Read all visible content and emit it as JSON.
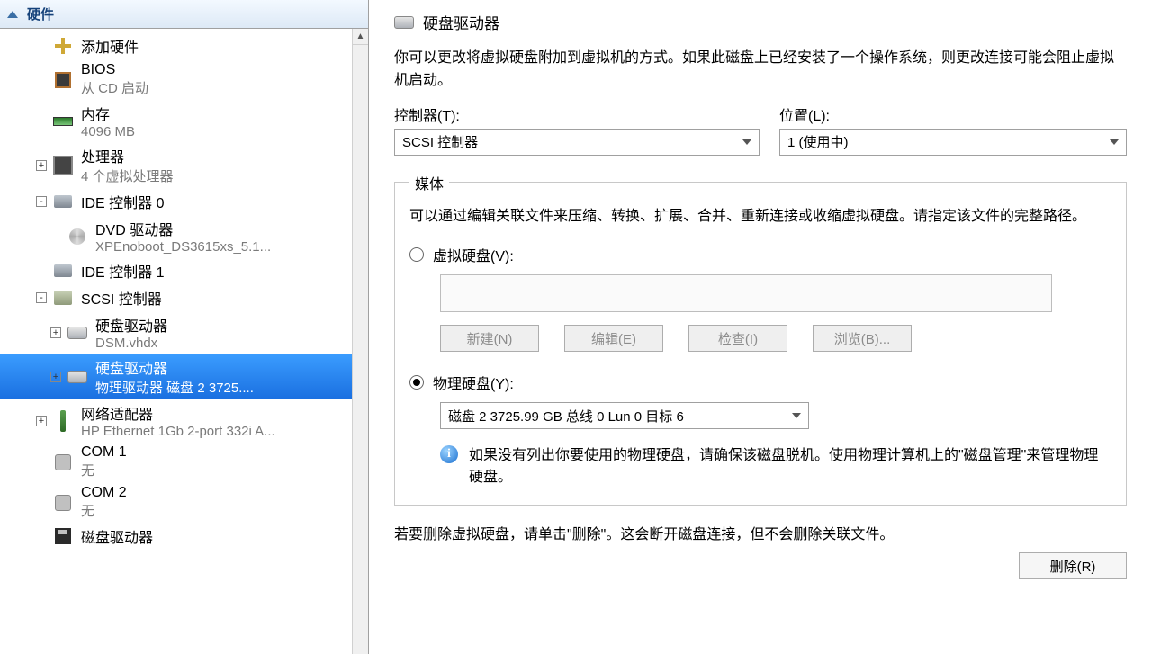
{
  "left": {
    "header": "硬件",
    "items": [
      {
        "label": "添加硬件",
        "sub": "",
        "icon": "plus"
      },
      {
        "label": "BIOS",
        "sub": "从 CD 启动",
        "icon": "chip"
      },
      {
        "label": "内存",
        "sub": "4096 MB",
        "icon": "ram"
      },
      {
        "label": "处理器",
        "sub": "4 个虚拟处理器",
        "icon": "cpu",
        "exp": "+"
      },
      {
        "label": "IDE 控制器 0",
        "sub": "",
        "icon": "ide",
        "exp": "-"
      },
      {
        "label": "DVD 驱动器",
        "sub": "XPEnoboot_DS3615xs_5.1...",
        "icon": "dvd",
        "indent": 2
      },
      {
        "label": "IDE 控制器 1",
        "sub": "",
        "icon": "ide"
      },
      {
        "label": "SCSI 控制器",
        "sub": "",
        "icon": "scsi",
        "exp": "-"
      },
      {
        "label": "硬盘驱动器",
        "sub": "DSM.vhdx",
        "icon": "hdd",
        "indent": 2,
        "exp": "+"
      },
      {
        "label": "硬盘驱动器",
        "sub": "物理驱动器 磁盘 2 3725....",
        "icon": "hdd",
        "indent": 2,
        "exp": "+",
        "selected": true
      },
      {
        "label": "网络适配器",
        "sub": "HP Ethernet 1Gb 2-port 332i A...",
        "icon": "nic",
        "exp": "+"
      },
      {
        "label": "COM 1",
        "sub": "无",
        "icon": "com"
      },
      {
        "label": "COM 2",
        "sub": "无",
        "icon": "com"
      },
      {
        "label": "磁盘驱动器",
        "sub": "",
        "icon": "floppy"
      }
    ]
  },
  "right": {
    "title": "硬盘驱动器",
    "desc": "你可以更改将虚拟硬盘附加到虚拟机的方式。如果此磁盘上已经安装了一个操作系统，则更改连接可能会阻止虚拟机启动。",
    "controllerLabel": "控制器(T):",
    "controllerValue": "SCSI 控制器",
    "locationLabel": "位置(L):",
    "locationValue": "1 (使用中)",
    "mediaLegend": "媒体",
    "mediaDesc": "可以通过编辑关联文件来压缩、转换、扩展、合并、重新连接或收缩虚拟硬盘。请指定该文件的完整路径。",
    "vhdRadioLabel": "虚拟硬盘(V):",
    "vhdValue": "",
    "btnNew": "新建(N)",
    "btnEdit": "编辑(E)",
    "btnCheck": "检查(I)",
    "btnBrowse": "浏览(B)...",
    "physRadioLabel": "物理硬盘(Y):",
    "physValue": "磁盘 2 3725.99 GB 总线 0 Lun 0 目标 6",
    "infoText": "如果没有列出你要使用的物理硬盘，请确保该磁盘脱机。使用物理计算机上的\"磁盘管理\"来管理物理硬盘。",
    "bottomText": "若要删除虚拟硬盘，请单击\"删除\"。这会断开磁盘连接，但不会删除关联文件。",
    "btnDelete": "删除(R)"
  }
}
